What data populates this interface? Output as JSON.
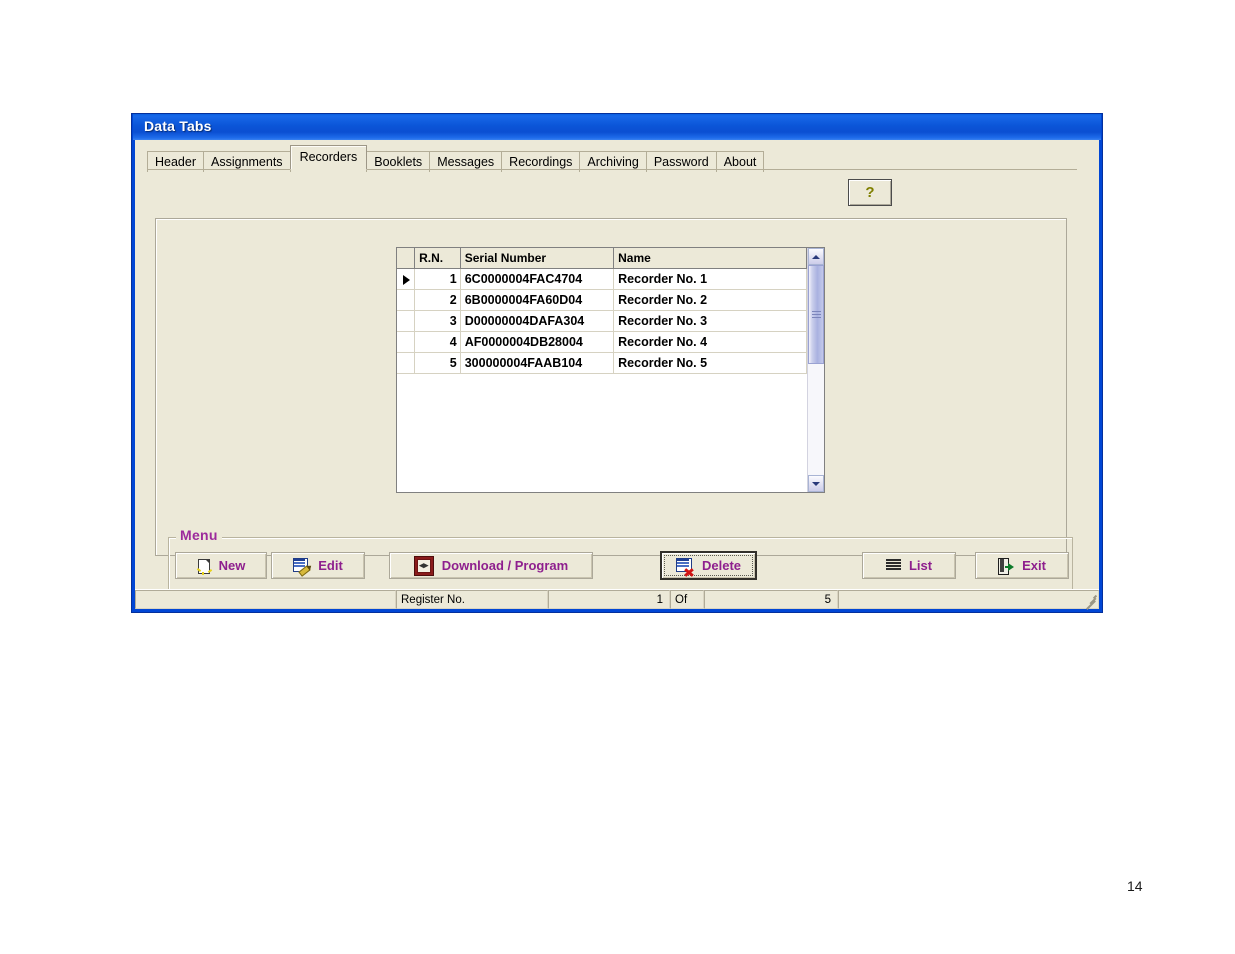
{
  "window": {
    "title": "Data Tabs",
    "title_bar_color": "#0b55d8",
    "client_color": "#ece9d8"
  },
  "tabs": [
    {
      "label": "Header",
      "selected": false
    },
    {
      "label": "Assignments",
      "selected": false
    },
    {
      "label": "Recorders",
      "selected": true
    },
    {
      "label": "Booklets",
      "selected": false
    },
    {
      "label": "Messages",
      "selected": false
    },
    {
      "label": "Recordings",
      "selected": false
    },
    {
      "label": "Archiving",
      "selected": false
    },
    {
      "label": "Password",
      "selected": false
    },
    {
      "label": "About",
      "selected": false
    }
  ],
  "help_button": {
    "glyph": "?",
    "icon": "question-mark-icon",
    "color": "#7f7f00"
  },
  "grid": {
    "columns": [
      "",
      "R.N.",
      "Serial Number",
      "Name"
    ],
    "rows": [
      {
        "marker": "▶",
        "rn": "1",
        "serial": "6C0000004FAC4704",
        "name": "Recorder No. 1"
      },
      {
        "marker": "",
        "rn": "2",
        "serial": "6B0000004FA60D04",
        "name": "Recorder No. 2"
      },
      {
        "marker": "",
        "rn": "3",
        "serial": "D00000004DAFA304",
        "name": "Recorder No. 3"
      },
      {
        "marker": "",
        "rn": "4",
        "serial": "AF0000004DB28004",
        "name": "Recorder No. 4"
      },
      {
        "marker": "",
        "rn": "5",
        "serial": "300000004FAAB104",
        "name": "Recorder No. 5"
      }
    ]
  },
  "menu": {
    "legend": "Menu",
    "legend_color": "#9c2a9c",
    "button_text_color": "#8e1f8e",
    "buttons": [
      {
        "label": "New",
        "icon": "new-page-icon",
        "focused": false
      },
      {
        "label": "Edit",
        "icon": "edit-grid-icon",
        "focused": false
      },
      {
        "label": "Download / Program",
        "icon": "download-icon",
        "focused": false
      },
      {
        "label": "Delete",
        "icon": "delete-row-icon",
        "focused": true
      },
      {
        "label": "List",
        "icon": "list-lines-icon",
        "focused": false
      },
      {
        "label": "Exit",
        "icon": "exit-door-icon",
        "focused": false
      }
    ]
  },
  "status_bar": {
    "register_label": "Register No.",
    "register_value": "1",
    "of_label": "Of",
    "total_value": "5"
  },
  "page": {
    "number": "14"
  }
}
